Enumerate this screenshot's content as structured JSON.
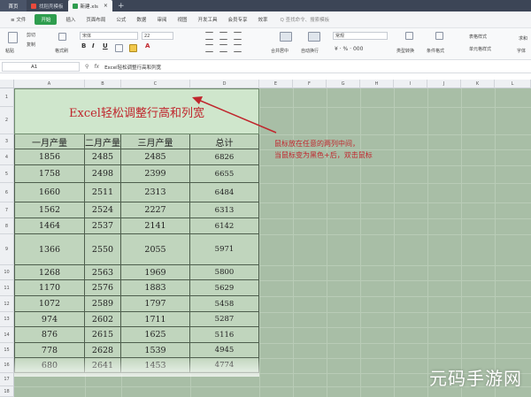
{
  "titlebar": {
    "tabs": [
      {
        "label": "首页",
        "kind": "home"
      },
      {
        "label": "找稻壳模板",
        "kind": "normal",
        "icon_color": "#e84a3c"
      },
      {
        "label": "新建.xls",
        "kind": "active",
        "icon_color": "#2e9d4e"
      }
    ],
    "add_label": "+"
  },
  "menubar": {
    "file_label": "≡ 文件",
    "items": [
      "开始",
      "插入",
      "页面布局",
      "公式",
      "数据",
      "审阅",
      "视图",
      "开发工具",
      "会员专享",
      "效率"
    ],
    "active_index": 0,
    "search_label": "Q 查找命令、搜索模板"
  },
  "ribbon": {
    "paste_label": "粘贴",
    "cut_label": "剪切",
    "copy_label": "复制",
    "format_painter_label": "格式刷",
    "font_name": "宋体",
    "font_size": "22",
    "bold": "B",
    "italic": "I",
    "underline": "U",
    "merge_label": "合并居中",
    "wrap_label": "自动换行",
    "number_format": "常规",
    "type_convert_label": "类型转换",
    "conditional_label": "条件格式",
    "table_style_label": "表格样式",
    "cell_style_label": "单元格样式",
    "sum_label": "求和",
    "fill_label": "字体"
  },
  "formulabar": {
    "cell_ref": "A1",
    "fx_label": "fx",
    "content": "Excel轻松调整行高和列宽"
  },
  "columns": [
    "A",
    "B",
    "C",
    "D",
    "E",
    "F",
    "G",
    "H",
    "I",
    "J",
    "K",
    "L"
  ],
  "rows": [
    "1",
    "2",
    "3",
    "4",
    "5",
    "6",
    "7",
    "8",
    "9",
    "10",
    "11",
    "12",
    "13",
    "14",
    "15",
    "16",
    "17",
    "18"
  ],
  "sheet": {
    "title": "Excel轻松调整行高和列宽",
    "headers": [
      "一月产量",
      "二月产量",
      "三月产量",
      "总计"
    ],
    "data": [
      [
        "1856",
        "2485",
        "2485",
        "6826"
      ],
      [
        "1758",
        "2498",
        "2399",
        "6655"
      ],
      [
        "1660",
        "2511",
        "2313",
        "6484"
      ],
      [
        "1562",
        "2524",
        "2227",
        "6313"
      ],
      [
        "1464",
        "2537",
        "2141",
        "6142"
      ],
      [
        "1366",
        "2550",
        "2055",
        "5971"
      ],
      [
        "1268",
        "2563",
        "1969",
        "5800"
      ],
      [
        "1170",
        "2576",
        "1883",
        "5629"
      ],
      [
        "1072",
        "2589",
        "1797",
        "5458"
      ],
      [
        "974",
        "2602",
        "1711",
        "5287"
      ],
      [
        "876",
        "2615",
        "1625",
        "5116"
      ],
      [
        "778",
        "2628",
        "1539",
        "4945"
      ],
      [
        "680",
        "2641",
        "1453",
        "4774"
      ]
    ]
  },
  "annotation": {
    "line1": "鼠标放在任意的两列中间，",
    "line2": "当鼠标变为黑色+后，双击鼠标"
  },
  "watermark": "元码手游网",
  "colors": {
    "accent": "#2e9d4e",
    "sheet_bg": "#a8bea6",
    "title_text": "#c0262d",
    "annotation": "#c0262d"
  }
}
